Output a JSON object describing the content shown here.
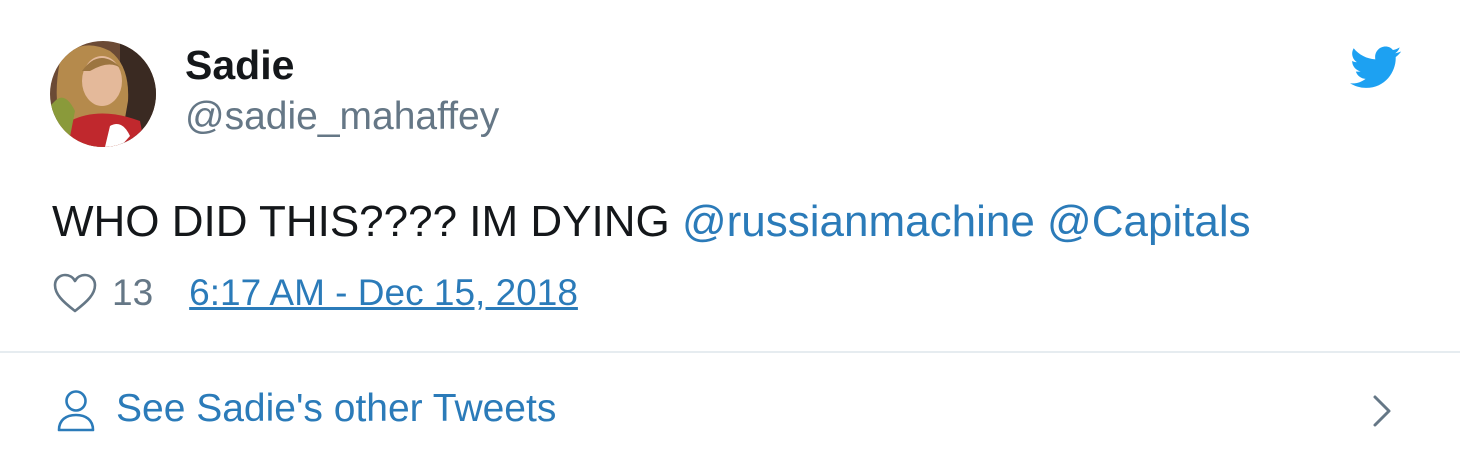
{
  "user": {
    "display_name": "Sadie",
    "handle": "@sadie_mahaffey",
    "avatar_icon": "user-photo-avatar"
  },
  "brand": {
    "logo_icon": "twitter-bird-icon",
    "accent_color": "#1da1f2",
    "link_color": "#2b7bb9"
  },
  "tweet": {
    "text": "WHO DID THIS???? IM DYING ",
    "mentions": [
      "@russianmachine",
      "@Capitals"
    ],
    "mention_separator": " "
  },
  "meta": {
    "like_icon": "heart-outline-icon",
    "like_count": "13",
    "timestamp": "6:17 AM - Dec 15, 2018"
  },
  "footer": {
    "person_icon": "person-icon",
    "label": "See Sadie's other Tweets",
    "chevron_icon": "chevron-right-icon"
  }
}
